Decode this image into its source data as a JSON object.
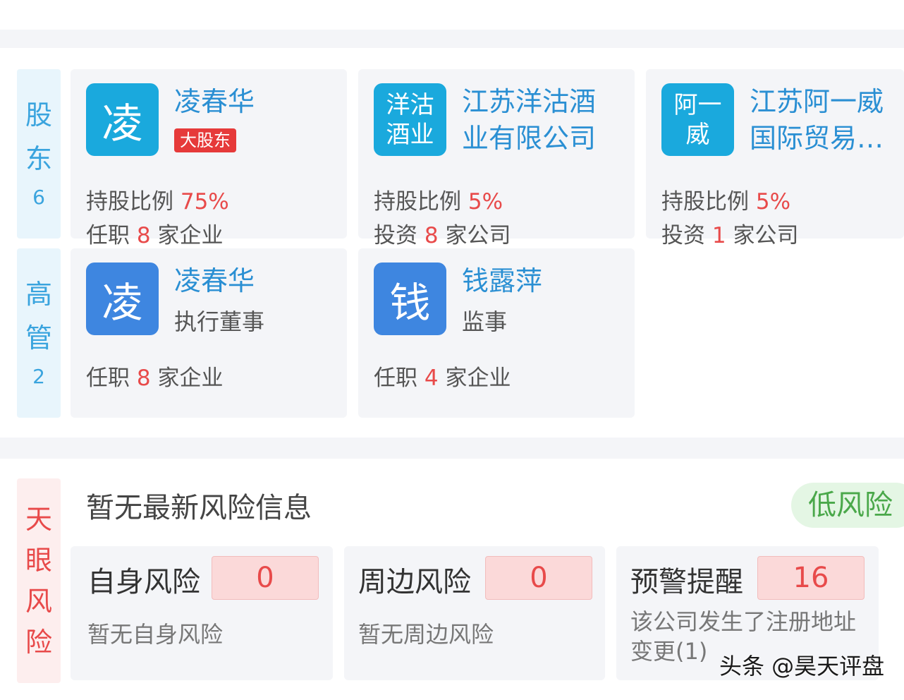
{
  "shareholders": {
    "label": "股东",
    "count": "6",
    "cards": [
      {
        "avatar": "凌",
        "name": "凌春华",
        "badge": "大股东",
        "ratio_label": "持股比例",
        "ratio": "75%",
        "sub_prefix": "任职",
        "sub_count": "8",
        "sub_suffix": "家企业"
      },
      {
        "avatar": "洋沽酒业",
        "name": "江苏洋沽酒业有限公司",
        "ratio_label": "持股比例",
        "ratio": "5%",
        "sub_prefix": "投资",
        "sub_count": "8",
        "sub_suffix": "家公司"
      },
      {
        "avatar": "阿一威",
        "name": "江苏阿一威国际贸易…",
        "ratio_label": "持股比例",
        "ratio": "5%",
        "sub_prefix": "投资",
        "sub_count": "1",
        "sub_suffix": "家公司"
      }
    ]
  },
  "executives": {
    "label": "高管",
    "count": "2",
    "cards": [
      {
        "avatar": "凌",
        "name": "凌春华",
        "role": "执行董事",
        "sub_prefix": "任职",
        "sub_count": "8",
        "sub_suffix": "家企业"
      },
      {
        "avatar": "钱",
        "name": "钱露萍",
        "role": "监事",
        "sub_prefix": "任职",
        "sub_count": "4",
        "sub_suffix": "家企业"
      }
    ]
  },
  "risk": {
    "label": "天眼风险",
    "title": "暂无最新风险信息",
    "level": "低风险",
    "cards": [
      {
        "name": "自身风险",
        "count": "0",
        "desc": "暂无自身风险"
      },
      {
        "name": "周边风险",
        "count": "0",
        "desc": "暂无周边风险"
      },
      {
        "name": "预警提醒",
        "count": "16",
        "desc": "该公司发生了注册地址变更(1)"
      }
    ]
  },
  "watermark": "头条 @昊天评盘",
  "colors": {
    "link_blue": "#2a8fd3",
    "alert_red": "#e84a4a",
    "low_risk_green": "#4aa84a",
    "avatar_teal": "#1aa9dd",
    "avatar_blue": "#3e86e0"
  }
}
